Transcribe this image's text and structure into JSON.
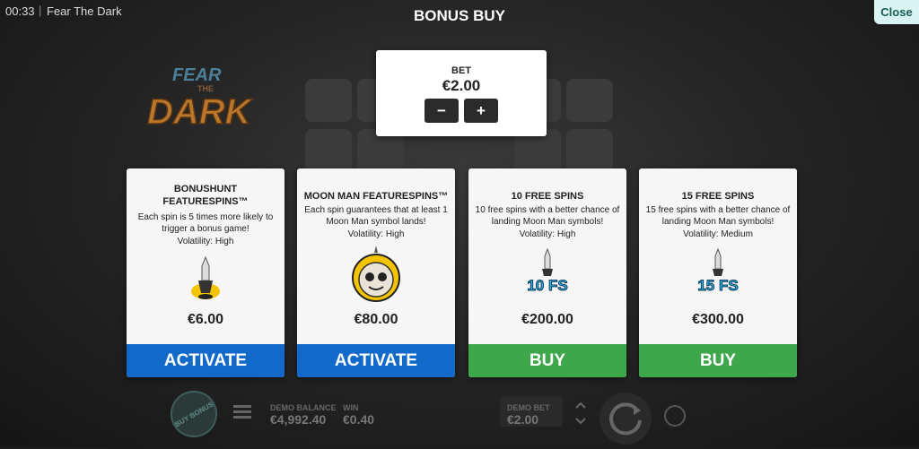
{
  "header": {
    "clock": "00:33",
    "separator": "|",
    "game_title": "Fear The Dark",
    "dialog_title": "BONUS BUY",
    "close_label": "Close"
  },
  "logo": {
    "line1": "FEAR",
    "line2": "THE",
    "line3": "DARK"
  },
  "bet": {
    "label": "BET",
    "value": "€2.00",
    "minus": "−",
    "plus": "+"
  },
  "cards": [
    {
      "title": "BONUSHUNT FEATURESPINS™",
      "desc": "Each spin is 5 times more likely to trigger a bonus game!",
      "volatility": "Volatility: High",
      "price": "€6.00",
      "button": "ACTIVATE",
      "icon": "lamp-icon"
    },
    {
      "title": "MOON MAN FEATURESPINS™",
      "desc": "Each spin guarantees that at least 1 Moon Man symbol lands!",
      "volatility": "Volatility: High",
      "price": "€80.00",
      "button": "ACTIVATE",
      "icon": "moon-man-icon"
    },
    {
      "title": "10 FREE SPINS",
      "desc": "10 free spins with a better chance of landing Moon Man symbols!",
      "volatility": "Volatility: High",
      "price": "€200.00",
      "button": "BUY",
      "icon": "10fs-icon",
      "badge": "10 FS"
    },
    {
      "title": "15 FREE SPINS",
      "desc": "15 free spins with a better chance of landing Moon Man symbols!",
      "volatility": "Volatility: Medium",
      "price": "€300.00",
      "button": "BUY",
      "icon": "15fs-icon",
      "badge": "15 FS"
    }
  ],
  "footer": {
    "buy_bonus": "BUY BONUS",
    "balance_label": "DEMO BALANCE",
    "balance_value": "€4,992.40",
    "win_label": "WIN",
    "win_value": "€0.40",
    "demo_bet_label": "DEMO BET",
    "demo_bet_value": "€2.00"
  },
  "colors": {
    "activate": "#1169c9",
    "buy": "#3ea64b",
    "close_bg": "#d8f3f0"
  }
}
